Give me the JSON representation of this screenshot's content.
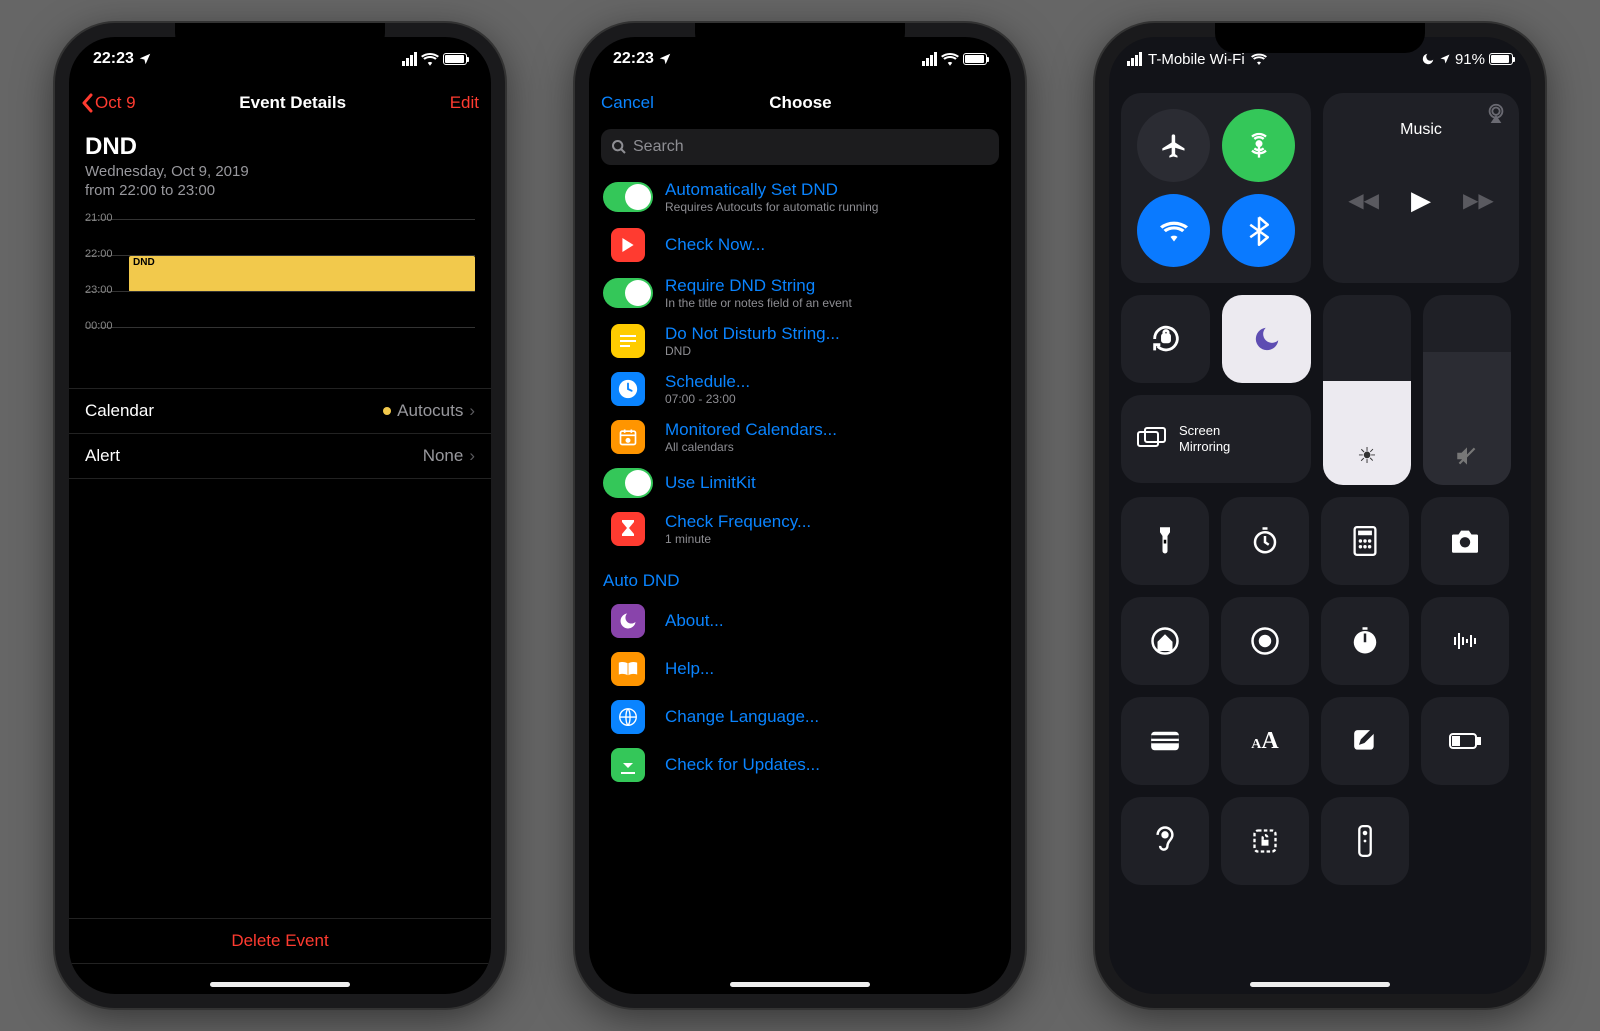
{
  "phone1": {
    "status": {
      "time": "22:23",
      "loc_arrow": true
    },
    "nav": {
      "back": "Oct 9",
      "title": "Event Details",
      "edit": "Edit"
    },
    "event": {
      "title": "DND",
      "date_line": "Wednesday, Oct 9, 2019",
      "time_line": "from 22:00 to 23:00",
      "graph_times": [
        "21:00",
        "22:00",
        "23:00",
        "00:00"
      ],
      "block_label": "DND"
    },
    "rows": {
      "calendar_label": "Calendar",
      "calendar_value": "Autocuts",
      "alert_label": "Alert",
      "alert_value": "None"
    },
    "delete": "Delete Event"
  },
  "phone2": {
    "status": {
      "time": "22:23"
    },
    "nav": {
      "cancel": "Cancel",
      "title": "Choose"
    },
    "search_placeholder": "Search",
    "items": [
      {
        "icon": "toggle",
        "title": "Automatically Set DND",
        "sub": "Requires Autocuts for automatic running"
      },
      {
        "icon": "play-red",
        "title": "Check Now..."
      },
      {
        "icon": "toggle",
        "title": "Require DND String",
        "sub": "In the title or notes field of an event"
      },
      {
        "icon": "text-yellow",
        "title": "Do Not Disturb String...",
        "sub": "DND"
      },
      {
        "icon": "clock-blue",
        "title": "Schedule...",
        "sub": "07:00 - 23:00"
      },
      {
        "icon": "cal-orange",
        "title": "Monitored Calendars...",
        "sub": "All calendars"
      },
      {
        "icon": "toggle",
        "title": "Use LimitKit"
      },
      {
        "icon": "hourglass-red",
        "title": "Check Frequency...",
        "sub": "1 minute"
      }
    ],
    "section": "Auto DND",
    "items2": [
      {
        "icon": "moon-purple",
        "title": "About..."
      },
      {
        "icon": "book-orange",
        "title": "Help..."
      },
      {
        "icon": "globe-blue",
        "title": "Change Language..."
      },
      {
        "icon": "download-green",
        "title": "Check for Updates..."
      }
    ]
  },
  "phone3": {
    "status": {
      "carrier": "T-Mobile Wi-Fi",
      "battery": "91%"
    },
    "conn": {
      "airplane_on": false,
      "cellular_on": true,
      "wifi_on": true,
      "bluetooth_on": true
    },
    "media": {
      "title": "Music"
    },
    "dnd_on": true,
    "brightness_pct": 55,
    "volume_pct": 70,
    "screen_mirroring": "Screen\nMirroring",
    "icons_row3": [
      "flashlight",
      "timer",
      "calculator",
      "camera"
    ],
    "icons_row4": [
      "home",
      "record",
      "stopwatch",
      "voice-memos"
    ],
    "icons_row5": [
      "wallet",
      "text-size",
      "notes",
      "low-power"
    ],
    "icons_row6": [
      "hearing",
      "guided-access",
      "remote"
    ]
  }
}
